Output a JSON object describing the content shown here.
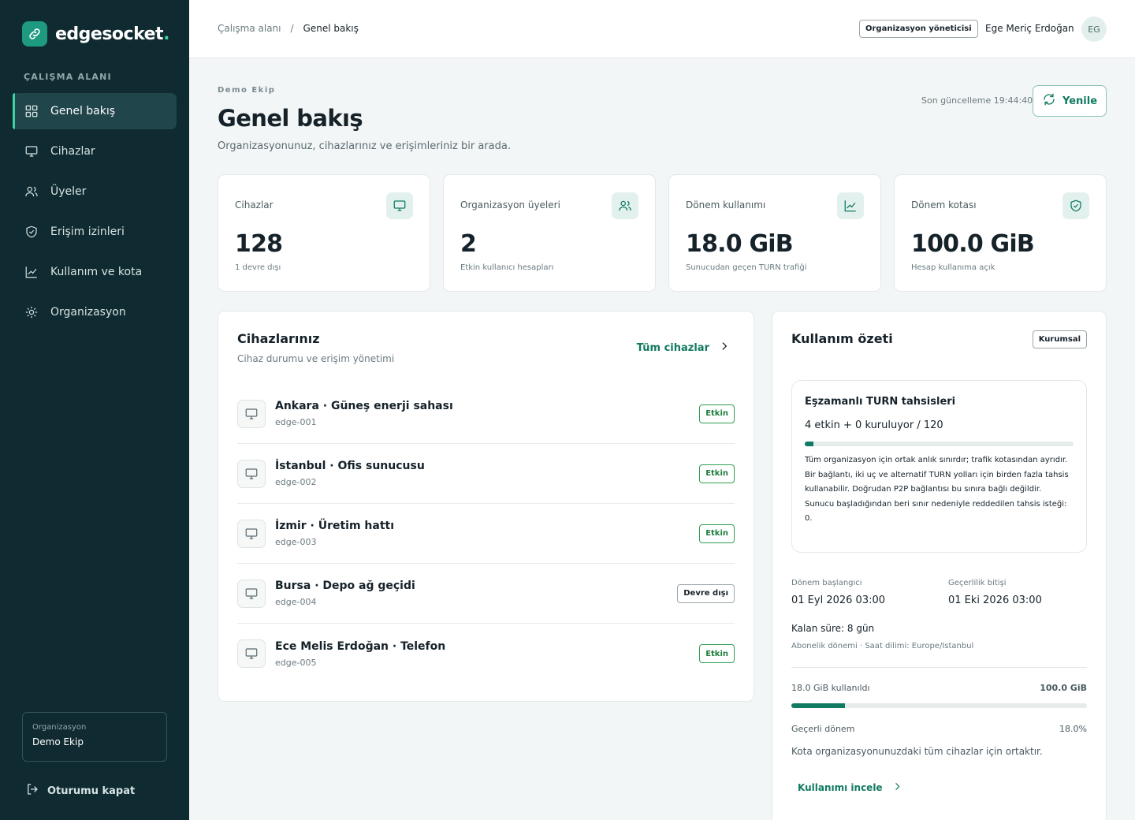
{
  "brand": {
    "name": "edgesocket",
    "dot": "."
  },
  "sidebar": {
    "section_label": "ÇALIŞMA ALANI",
    "items": [
      {
        "label": "Genel bakış",
        "icon": "grid-icon",
        "active": true
      },
      {
        "label": "Cihazlar",
        "icon": "monitor-icon"
      },
      {
        "label": "Üyeler",
        "icon": "users-icon"
      },
      {
        "label": "Erişim izinleri",
        "icon": "shield-icon"
      },
      {
        "label": "Kullanım ve kota",
        "icon": "chart-icon"
      },
      {
        "label": "Organizasyon",
        "icon": "sun-icon"
      }
    ],
    "org_label": "Organizasyon",
    "org_name": "Demo Ekip",
    "logout": "Oturumu kapat"
  },
  "topbar": {
    "breadcrumb": [
      "Çalışma alanı",
      "/",
      "Genel bakış"
    ],
    "role_badge": "Organizasyon yöneticisi",
    "user_name": "Ege Meriç Erdoğan",
    "avatar_initials": "EG"
  },
  "header": {
    "eyebrow": "Demo Ekip",
    "title": "Genel bakış",
    "subtitle": "Organizasyonunuz, cihazlarınız ve erişimleriniz bir arada.",
    "last_update": "Son güncelleme 19:44:40",
    "refresh": "Yenile"
  },
  "stats": [
    {
      "label": "Cihazlar",
      "value": "128",
      "note": "1 devre dışı",
      "icon": "monitor-icon"
    },
    {
      "label": "Organizasyon üyeleri",
      "value": "2",
      "note": "Etkin kullanıcı hesapları",
      "icon": "users-icon"
    },
    {
      "label": "Dönem kullanımı",
      "value": "18.0 GiB",
      "note": "Sunucudan geçen TURN trafiği",
      "icon": "chart-icon"
    },
    {
      "label": "Dönem kotası",
      "value": "100.0 GiB",
      "note": "Hesap kullanıma açık",
      "icon": "shield-check-icon"
    }
  ],
  "devices": {
    "title": "Cihazlarınız",
    "subtitle": "Cihaz durumu ve erişim yönetimi",
    "all_link": "Tüm cihazlar",
    "rows": [
      {
        "name": "Ankara · Güneş enerji sahası",
        "id": "edge-001",
        "status": "Etkin",
        "active": true
      },
      {
        "name": "İstanbul · Ofis sunucusu",
        "id": "edge-002",
        "status": "Etkin",
        "active": true
      },
      {
        "name": "İzmir · Üretim hattı",
        "id": "edge-003",
        "status": "Etkin",
        "active": true
      },
      {
        "name": "Bursa · Depo ağ geçidi",
        "id": "edge-004",
        "status": "Devre dışı",
        "active": false
      },
      {
        "name": "Ece Melis Erdoğan · Telefon",
        "id": "edge-005",
        "status": "Etkin",
        "active": true
      }
    ]
  },
  "usage": {
    "title": "Kullanım özeti",
    "plan": "Kurumsal",
    "turn": {
      "title": "Eşzamanlı TURN tahsisleri",
      "count": "4 etkin + 0 kuruluyor / 120",
      "fraction": 0.0333,
      "desc1": "Tüm organizasyon için ortak anlık sınırdır; trafik kotasından ayrıdır. Bir bağlantı, iki uç ve alternatif TURN yolları için birden fazla tahsis kullanabilir. Doğrudan P2P bağlantısı bu sınıra bağlı değildir.",
      "desc2": "Sunucu başladığından beri sınır nedeniyle reddedilen tahsis isteği: 0."
    },
    "period_start_label": "Dönem başlangıcı",
    "period_start": "01 Eyl 2026 03:00",
    "period_end_label": "Geçerlilik bitişi",
    "period_end": "01 Eki 2026 03:00",
    "remaining": "Kalan süre: 8 gün",
    "tz_note": "Abonelik dönemi · Saat dilimi: Europe/Istanbul",
    "used_label": "18.0 GiB kullanıldı",
    "quota_label": "100.0 GiB",
    "quota_fraction": 0.18,
    "period_name": "Geçerli dönem",
    "period_pct": "18.0%",
    "shared_note": "Kota organizasyonunuzdaki tüm cihazlar için ortaktır.",
    "link": "Kullanımı incele"
  },
  "colors": {
    "accent": "#117a62",
    "sidebar": "#0f2a30",
    "active_nav": "#20454b"
  }
}
